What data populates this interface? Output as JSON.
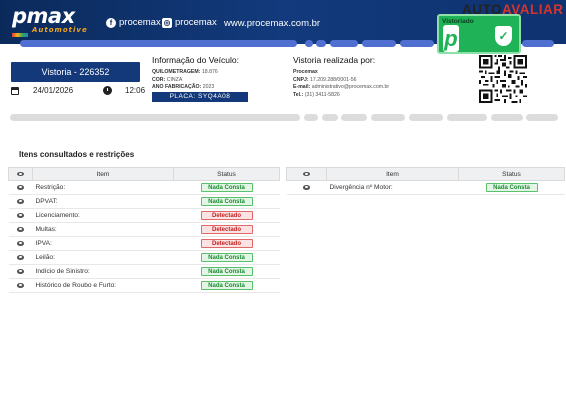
{
  "header": {
    "logo_main": "pmax",
    "logo_sub": "Automotive",
    "social": [
      {
        "icon": "facebook-icon",
        "glyph": "f",
        "label": "procemax"
      },
      {
        "icon": "instagram-icon",
        "glyph": "◎",
        "label": "procemax"
      }
    ],
    "website": "www.procemax.com.br",
    "badge_label": "Vistoriado",
    "brand_left": "AUTO",
    "brand_right": "AVALIAR"
  },
  "vistoria": {
    "label": "Vistoria - 226352",
    "date": "24/01/2026",
    "time": "12:06"
  },
  "vehicle": {
    "title": "Informação do Veículo:",
    "odometer_label": "QUILOMETRAGEM:",
    "odometer": "18.876",
    "color_label": "COR:",
    "color": "CINZA",
    "year_label": "ANO FABRICAÇÃO:",
    "year": "2023",
    "plate": "PLACA: SYQ4A08"
  },
  "performed_by": {
    "title": "Vistoria realizada por:",
    "company": "Procemax",
    "cnpj_label": "CNPJ:",
    "cnpj": "17.209.288/0001-56",
    "email_label": "E-mail:",
    "email": "administrativo@procemax.com.br",
    "phone_label": "Tel.:",
    "phone": "(31) 3411-5826"
  },
  "restrictions": {
    "title": "Itens consultados e restrições",
    "columns": {
      "item": "Item",
      "status": "Status"
    },
    "left": [
      {
        "item": "Restrição:",
        "status": "Nada Consta",
        "ok": true
      },
      {
        "item": "DPVAT:",
        "status": "Nada Consta",
        "ok": true
      },
      {
        "item": "Licenciamento:",
        "status": "Detectado",
        "ok": false
      },
      {
        "item": "Multas:",
        "status": "Detectado",
        "ok": false
      },
      {
        "item": "IPVA:",
        "status": "Detectado",
        "ok": false
      },
      {
        "item": "Leilão:",
        "status": "Nada Consta",
        "ok": true
      },
      {
        "item": "Indício de Sinistro:",
        "status": "Nada Consta",
        "ok": true
      },
      {
        "item": "Histórico de Roubo e Furto:",
        "status": "Nada Consta",
        "ok": true
      }
    ],
    "right": [
      {
        "item": "Divergência nº Motor:",
        "status": "Nada Consta",
        "ok": true
      }
    ]
  },
  "colors": {
    "header_bg": "#123a7c",
    "accent_blue": "#13397a",
    "ok_green": "#1e8a34",
    "alert_red": "#c22222"
  }
}
